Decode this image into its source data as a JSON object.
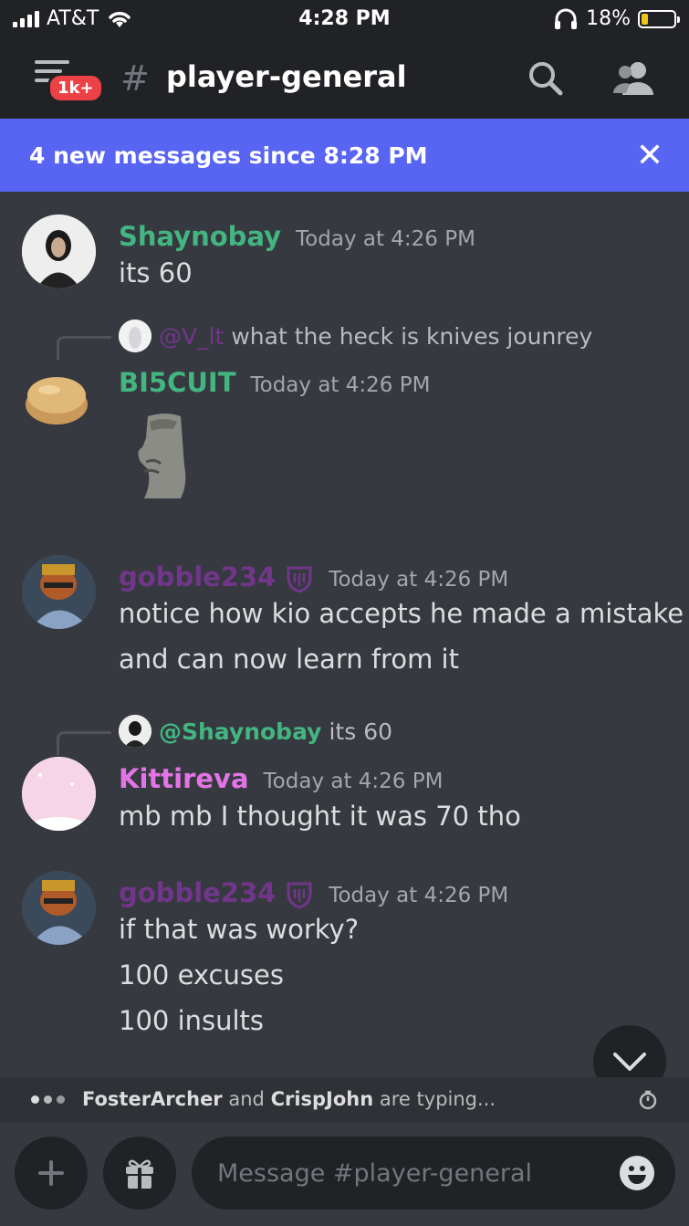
{
  "status_bar": {
    "carrier": "AT&T",
    "time": "4:28 PM",
    "battery": "18%"
  },
  "header": {
    "badge": "1k+",
    "channel": "player-general"
  },
  "new_messages": {
    "label": "4 new messages since 8:28 PM",
    "close": "✕"
  },
  "messages": [
    {
      "author": "Shaynobay",
      "author_color": "#43b581",
      "timestamp": "Today at 4:26 PM",
      "lines": [
        "its 60"
      ]
    },
    {
      "reply_to": "@V_lt",
      "reply_text": "what the heck is knives jounrey",
      "author": "BI5CUIT",
      "author_color": "#43b581",
      "timestamp": "Today at 4:26 PM",
      "sticker": "moai-emoji"
    },
    {
      "author": "gobble234",
      "author_color": "#71368a",
      "timestamp": "Today at 4:26 PM",
      "lines": [
        "notice how kio accepts he made a mistake",
        "and can now learn from it"
      ]
    },
    {
      "reply_to": "@Shaynobay",
      "reply_text": "its 60",
      "author": "Kittireva",
      "author_color": "#e374e6",
      "timestamp": "Today at 4:26 PM",
      "lines": [
        "mb mb I thought it was 70 tho"
      ]
    },
    {
      "author": "gobble234",
      "author_color": "#71368a",
      "timestamp": "Today at 4:26 PM",
      "lines": [
        "if that was worky?",
        "100 excuses",
        "100 insults"
      ]
    }
  ],
  "typing": {
    "user1": "FosterArcher",
    "middle": "and",
    "user2": "CrispJohn",
    "suffix": "are typing..."
  },
  "composer": {
    "placeholder": "Message #player-general"
  }
}
